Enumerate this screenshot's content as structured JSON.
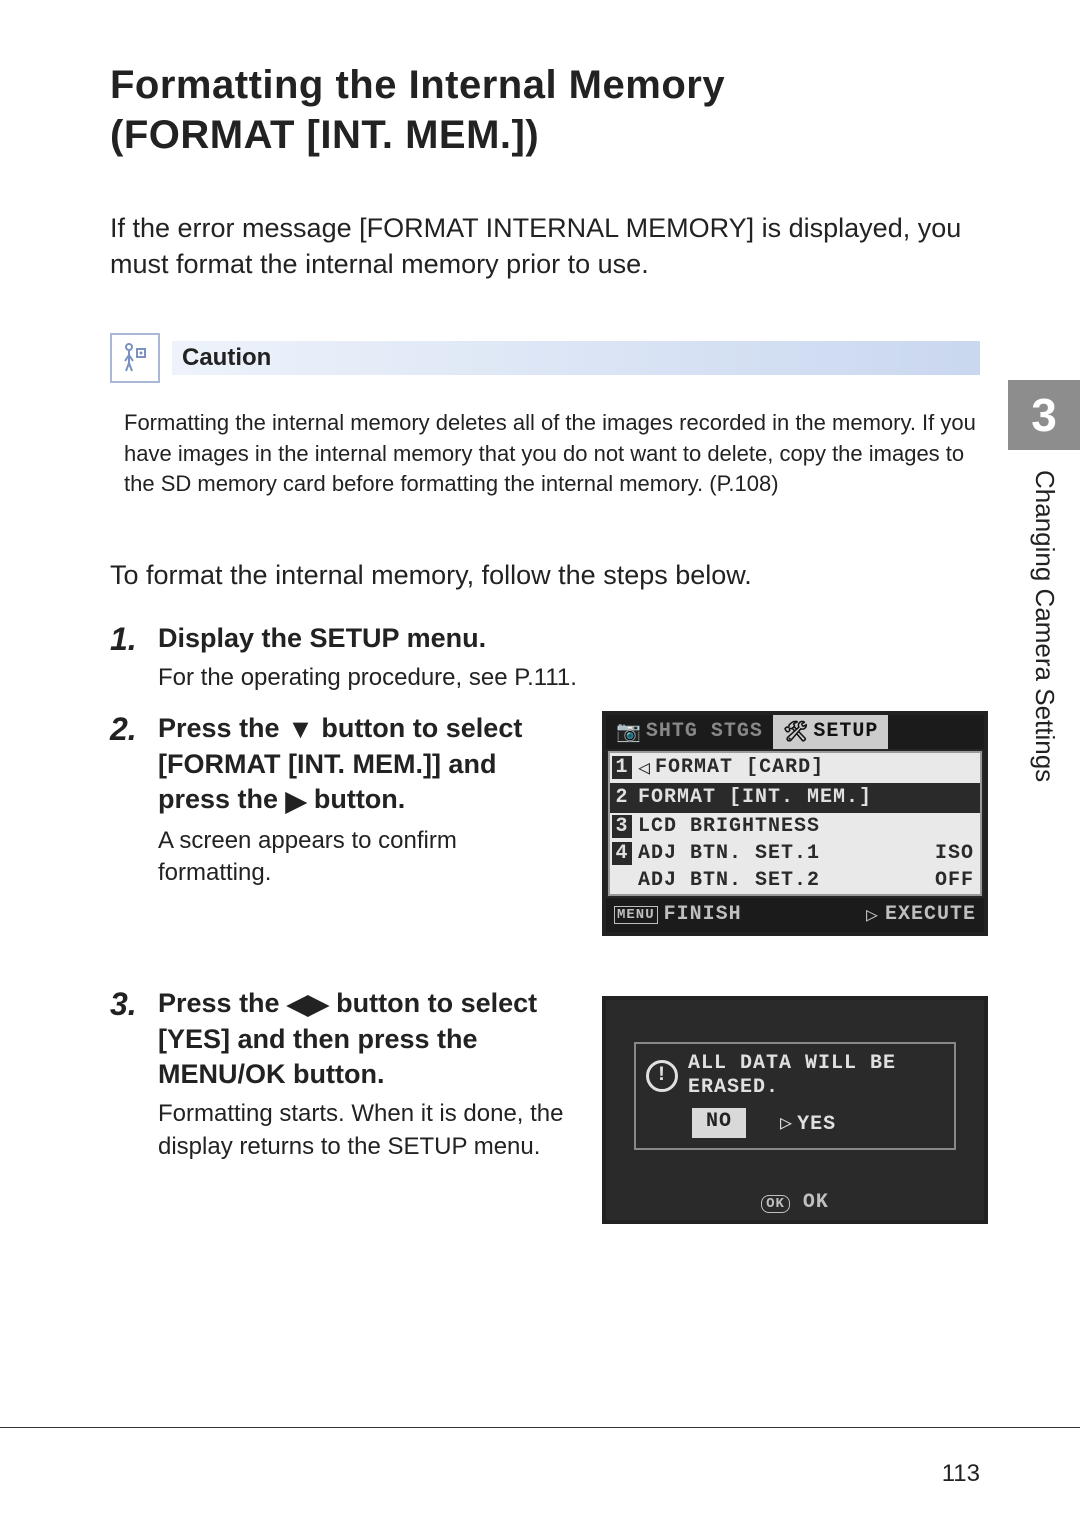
{
  "title_line1": "Formatting the Internal Memory",
  "title_line2": "(FORMAT [INT. MEM.])",
  "intro": "If the error message [FORMAT INTERNAL MEMORY] is displayed, you must format the internal memory prior to use.",
  "caution_label": "Caution",
  "caution_body": "Formatting the internal memory deletes all of the images recorded in the memory. If you have images in the internal memory that you do not want to delete, copy the images to the SD memory card before formatting the internal memory. (P.108)",
  "lead": "To format the internal memory, follow the steps below.",
  "steps": {
    "s1": {
      "num": "1.",
      "title": "Display the SETUP menu.",
      "body": "For the operating procedure, see P.111."
    },
    "s2": {
      "num": "2.",
      "title_a": "Press the ",
      "title_b": " button to select [FORMAT [INT. MEM.]] and press the ",
      "title_c": " button.",
      "body": "A screen appears to confirm formatting."
    },
    "s3": {
      "num": "3.",
      "title_a": "Press the ",
      "title_b": " button to select [YES] and then press the ",
      "menu_ok": "MENU/OK",
      "title_c": " button.",
      "body": "Formatting starts. When it is done, the display returns to the SETUP menu."
    }
  },
  "lcd1": {
    "tab_left": "SHTG STGS",
    "tab_right": "SETUP",
    "rows": [
      {
        "idx": "1",
        "label": "FORMAT [CARD]",
        "value": "",
        "sel": false,
        "arrow": "◁"
      },
      {
        "idx": "2",
        "label": "FORMAT [INT. MEM.]",
        "value": "",
        "sel": true,
        "arrow": "▷"
      },
      {
        "idx": "3",
        "label": "LCD BRIGHTNESS",
        "value": "",
        "sel": false,
        "arrow": ""
      },
      {
        "idx": "4",
        "label": "ADJ BTN. SET.1",
        "value": "ISO",
        "sel": false,
        "arrow": ""
      },
      {
        "idx": "",
        "label": "ADJ BTN. SET.2",
        "value": "OFF",
        "sel": false,
        "arrow": ""
      }
    ],
    "footer_left_key": "MENU",
    "footer_left": "FINISH",
    "footer_right_key": "▷",
    "footer_right": "EXECUTE"
  },
  "lcd2": {
    "msg_l1": "ALL DATA WILL BE",
    "msg_l2": "ERASED.",
    "no": "NO",
    "yes": "YES",
    "ok_key": "OK",
    "ok_label": "OK"
  },
  "side": {
    "chapter_num": "3",
    "chapter_title": "Changing Camera Settings"
  },
  "page_number": "113"
}
